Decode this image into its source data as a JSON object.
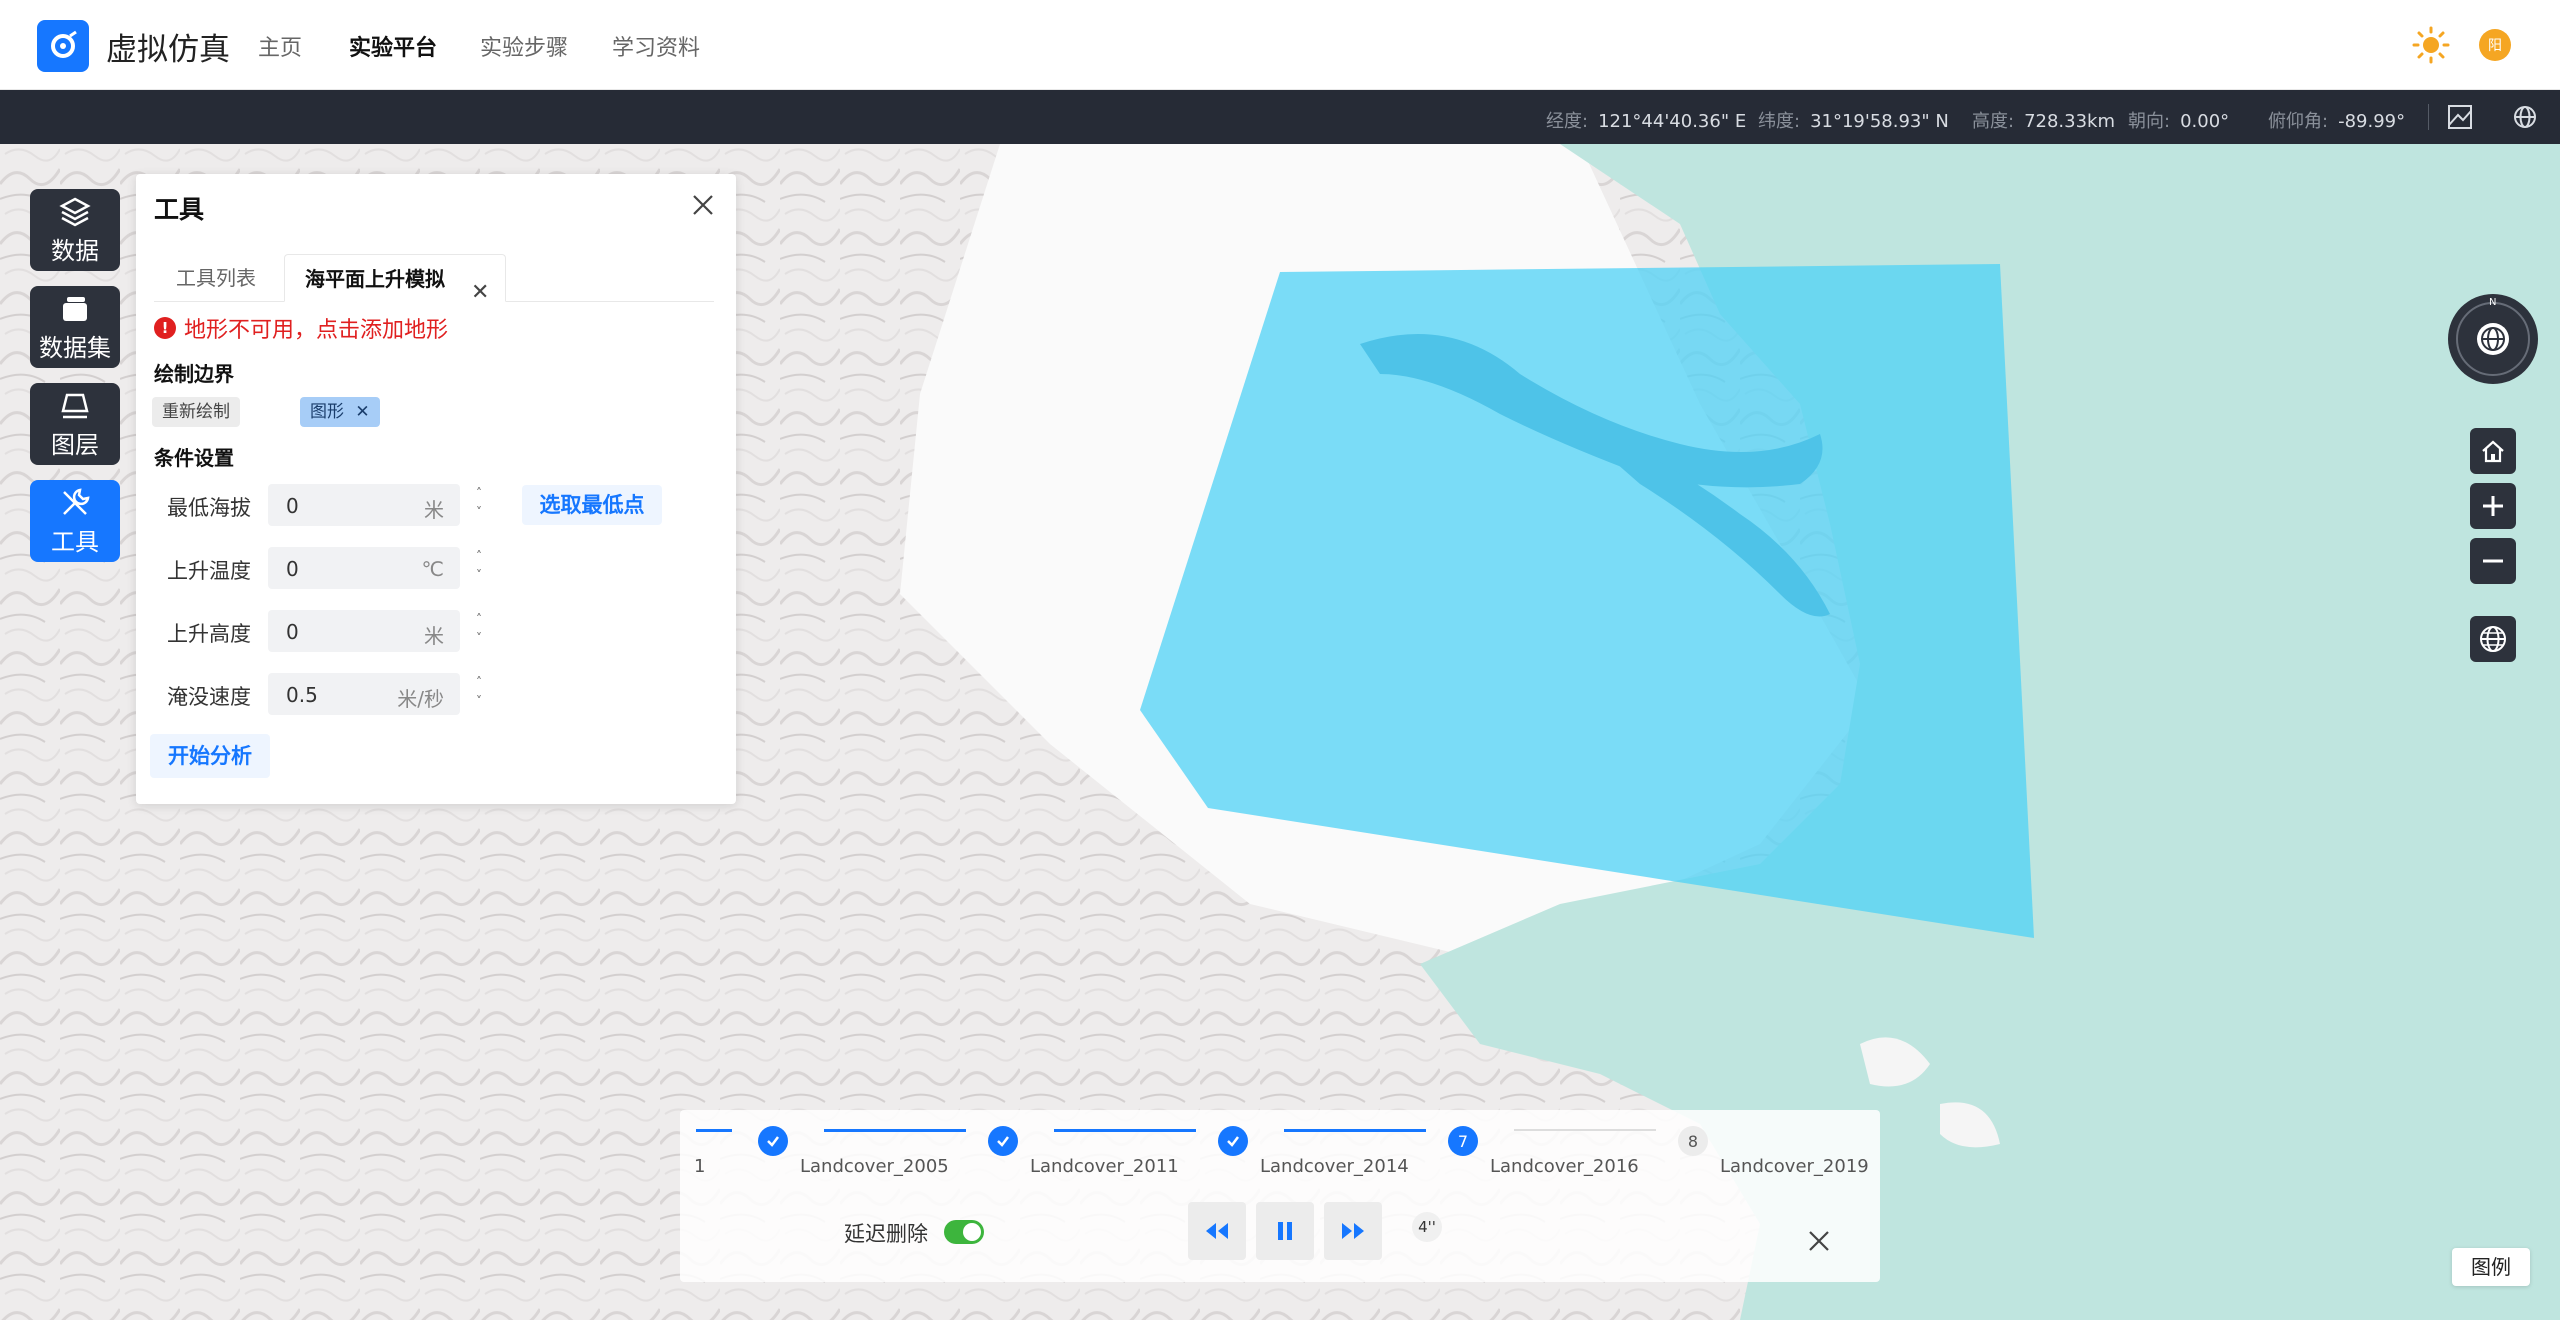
{
  "header": {
    "app_title": "虚拟仿真",
    "nav": [
      {
        "label": "主页",
        "active": false
      },
      {
        "label": "实验平台",
        "active": true
      },
      {
        "label": "实验步骤",
        "active": false
      },
      {
        "label": "学习资料",
        "active": false
      }
    ],
    "avatar_text": "阳",
    "theme_icon": "sun-icon"
  },
  "statusbar": {
    "lon_label": "经度:",
    "lon_value": "121°44'40.36\" E",
    "lat_label": "纬度:",
    "lat_value": "31°19'58.93\" N",
    "alt_label": "高度:",
    "alt_value": "728.33km",
    "heading_label": "朝向:",
    "heading_value": "0.00°",
    "pitch_label": "俯仰角:",
    "pitch_value": "-89.99°"
  },
  "sidebar": {
    "items": [
      {
        "label": "数据",
        "icon": "layers-icon",
        "active": false
      },
      {
        "label": "数据集",
        "icon": "dataset-icon",
        "active": false
      },
      {
        "label": "图层",
        "icon": "layer-icon",
        "active": false
      },
      {
        "label": "工具",
        "icon": "tools-icon",
        "active": true
      }
    ]
  },
  "panel": {
    "title": "工具",
    "tabs": [
      {
        "label": "工具列表",
        "active": false
      },
      {
        "label": "海平面上升模拟",
        "active": true
      }
    ],
    "tab_close": "✕",
    "error": "地形不可用，点击添加地形",
    "draw_boundary": "绘制边界",
    "redraw_label": "重新绘制",
    "shape_chip": "图形",
    "shape_chip_close": "✕",
    "conditions": "条件设置",
    "fields": [
      {
        "label": "最低海拔",
        "value": "0",
        "unit": "米"
      },
      {
        "label": "上升温度",
        "value": "0",
        "unit": "℃"
      },
      {
        "label": "上升高度",
        "value": "0",
        "unit": "米"
      },
      {
        "label": "淹没速度",
        "value": "0.5",
        "unit": "米/秒"
      }
    ],
    "pick_lowest": "选取最低点",
    "analyze": "开始分析"
  },
  "timeline": {
    "steps": [
      {
        "number": "",
        "label": "Landcover_2005",
        "status": "done"
      },
      {
        "number": "",
        "label": "Landcover_2011",
        "status": "done"
      },
      {
        "number": "",
        "label": "Landcover_2014",
        "status": "done"
      },
      {
        "number": "7",
        "label": "Landcover_2016",
        "status": "current"
      },
      {
        "number": "8",
        "label": "Landcover_2019",
        "status": "pending"
      }
    ],
    "partial_label": "1",
    "delay_delete": "延迟删除",
    "delay_enabled": true,
    "speed": "4''"
  },
  "map": {
    "legend": "图例",
    "compass_north": "N",
    "colors": {
      "sea": "#bfe5df",
      "land": "#efeded",
      "polygon": "#4fd2f5"
    }
  }
}
